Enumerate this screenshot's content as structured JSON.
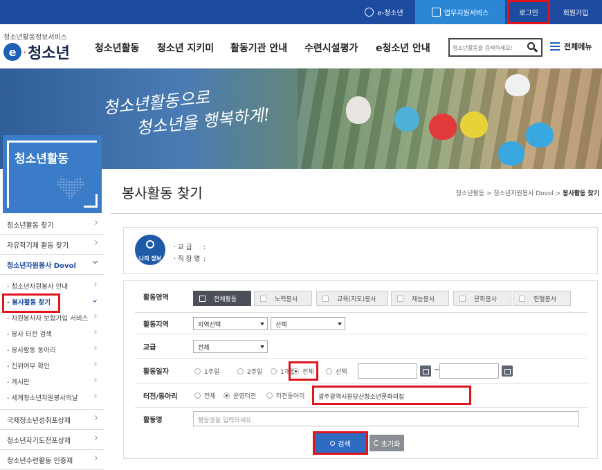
{
  "topbar": {
    "e_youth": "e-청소년",
    "work_support": "업무지원서비스",
    "login": "로그인",
    "join": "회원가입"
  },
  "header": {
    "logo_sub": "청소년활동정보서비스",
    "logo_text": "청소년",
    "logo_e": "e",
    "nav": [
      "청소년활동",
      "청소년 지키미",
      "활동기관 안내",
      "수련시설평가",
      "e청소년 안내"
    ],
    "search_placeholder": "청소년활동을 검색하세요!",
    "all_menu": "전체메뉴"
  },
  "banner": {
    "slogan_line1": "청소년활동으로",
    "slogan_line2": "청소년을 행복하게!"
  },
  "sidebar": {
    "title": "청소년활동",
    "items_top": [
      "청소년활동 찾기",
      "자유학기제 활동 찾기"
    ],
    "open_item": "청소년자원봉사 Dovol",
    "sub_items": [
      "- 청소년자원봉사 안내",
      "- 봉사활동 찾기",
      "- 자원봉사자 보험가입 서비스",
      "- 봉사 터전 검색",
      "- 봉사활동 동아리",
      "- 진위여부 확인",
      "- 게시판",
      "- 세계청소년자원봉사의날"
    ],
    "items_bottom": [
      "국제청소년성취포상제",
      "청소년자기도전포상제",
      "청소년수련활동 인증제"
    ]
  },
  "content": {
    "page_title": "봉사활동 찾기",
    "breadcrumb_1": "청소년활동",
    "breadcrumb_2": "청소년자원봉사 Dovol",
    "breadcrumb_3": "봉사활동 찾기",
    "myinfo_badge": "나의 정보",
    "myinfo_school_label": "· 교 급",
    "myinfo_work_label": "· 직 장 명",
    "myinfo_sep": ":"
  },
  "form": {
    "area_label": "활동영역",
    "area_tabs": [
      "전체활동",
      "노력봉사",
      "교육(지도)봉사",
      "재능봉사",
      "문화봉사",
      "헌혈봉사"
    ],
    "region_label": "활동지역",
    "region_select1": "지역선택",
    "region_select2": "선택",
    "school_label": "교급",
    "school_select": "전체",
    "date_label": "활동일자",
    "date_options": [
      "1주일",
      "2주일",
      "1개월",
      "전체",
      "선택"
    ],
    "date_tilde": "~",
    "site_label": "터전/동아리",
    "site_options": [
      "전체",
      "운영터전",
      "터전동아리"
    ],
    "site_value": "광주광역시원당산청소년문화의집",
    "name_label": "활동명",
    "name_placeholder": "활동명을 입력하세요.",
    "search_button": "검색",
    "reset_button": "초기화"
  },
  "colors": {
    "topbar": "#1d4ba0",
    "accent": "#2b87d6",
    "highlight": "#e0141e",
    "sidebar_head": "#3b7cc8"
  }
}
